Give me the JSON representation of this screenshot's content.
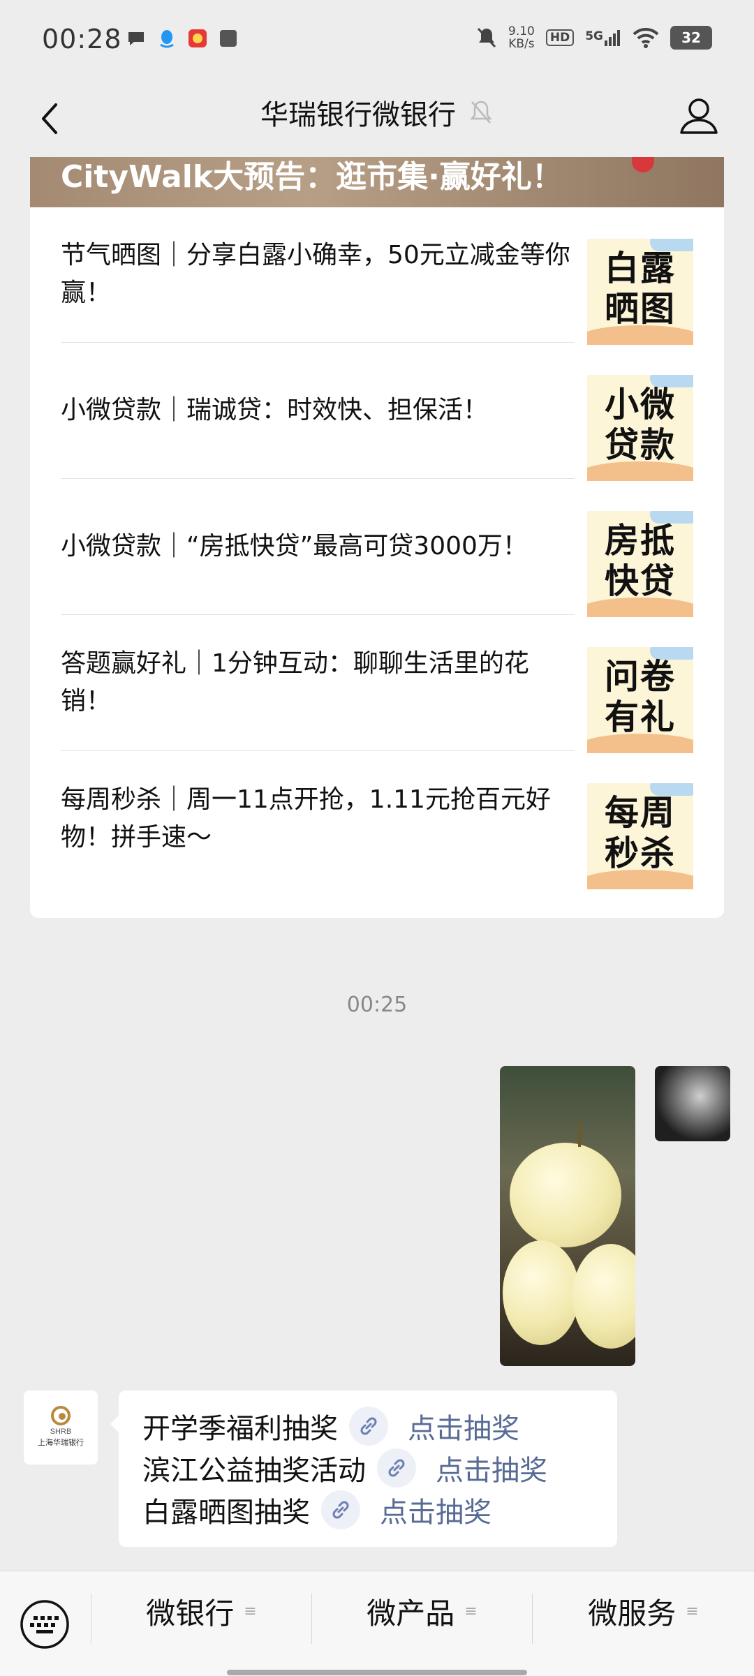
{
  "status_bar": {
    "time": "00:28",
    "net_speed": "9.10",
    "net_unit": "KB/s",
    "hd": "HD",
    "signal": "5G",
    "battery": "32"
  },
  "nav": {
    "title": "华瑞银行微银行"
  },
  "card": {
    "banner_text": "CityWalk大预告：逛市集·赢好礼！",
    "items": [
      {
        "title": "节气晒图｜分享白露小确幸，50元立减金等你赢！",
        "thumb": "白露晒图"
      },
      {
        "title": "小微贷款｜瑞诚贷：时效快、担保活！",
        "thumb": "小微贷款"
      },
      {
        "title": "小微贷款｜“房抵快贷”最高可贷3000万！",
        "thumb": "房抵快贷"
      },
      {
        "title": "答题赢好礼｜1分钟互动：聊聊生活里的花销！",
        "thumb": "问卷有礼"
      },
      {
        "title": "每周秒杀｜周一11点开抢，1.11元抢百元好物！拼手速～",
        "thumb": "每周秒杀"
      }
    ]
  },
  "chat": {
    "timestamp": "00:25",
    "bot_logo_en": "SHRB",
    "bot_logo_cn": "上海华瑞银行",
    "lines": [
      {
        "text": "开学季福利抽奖",
        "link": "点击抽奖"
      },
      {
        "text": "滨江公益抽奖活动",
        "link": "点击抽奖"
      },
      {
        "text": "白露晒图抽奖",
        "link": "点击抽奖"
      }
    ]
  },
  "bottom_menu": {
    "items": [
      "微银行",
      "微产品",
      "微服务"
    ],
    "menu_indicator": "≡"
  },
  "colors": {
    "link": "#576b95",
    "background": "#ededed"
  }
}
